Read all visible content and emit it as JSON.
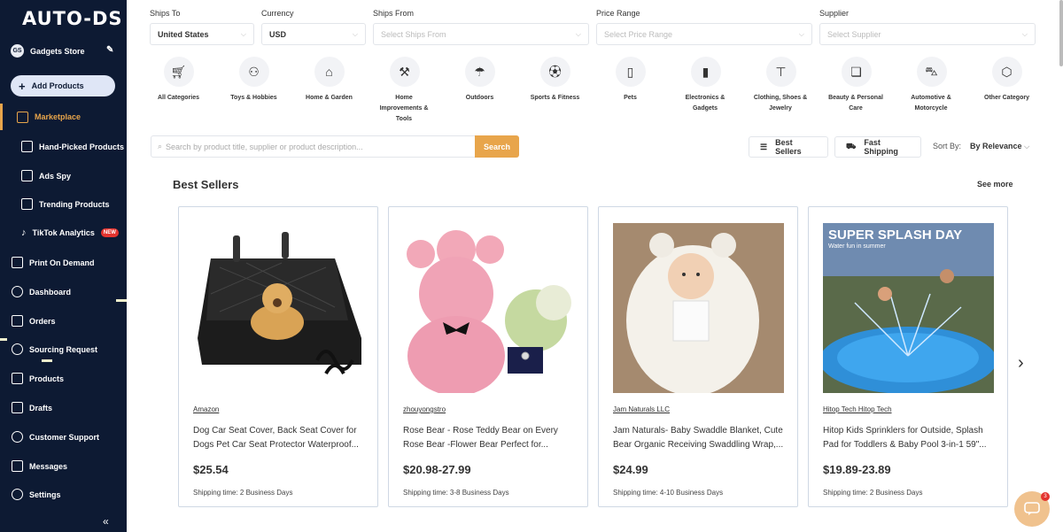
{
  "sidebar": {
    "logo": "AUTO-DS",
    "store_initials": "GS",
    "store_name": "Gadgets Store",
    "add_products": "Add Products",
    "items": {
      "marketplace": "Marketplace",
      "hand_picked": "Hand-Picked Products",
      "ads_spy": "Ads Spy",
      "trending": "Trending Products",
      "tiktok": "TikTok Analytics",
      "tiktok_badge": "NEW",
      "print_on_demand": "Print On Demand",
      "dashboard": "Dashboard",
      "orders": "Orders",
      "sourcing": "Sourcing Request",
      "products": "Products",
      "drafts": "Drafts",
      "support": "Customer Support",
      "messages": "Messages",
      "settings": "Settings"
    },
    "collapse_glyph": "«"
  },
  "filters": {
    "ships_to": {
      "label": "Ships To",
      "value": "United States"
    },
    "currency": {
      "label": "Currency",
      "value": "USD"
    },
    "ships_from": {
      "label": "Ships From",
      "placeholder": "Select Ships From"
    },
    "price_range": {
      "label": "Price Range",
      "placeholder": "Select Price Range"
    },
    "supplier": {
      "label": "Supplier",
      "placeholder": "Select Supplier"
    }
  },
  "categories": [
    {
      "label": "All Categories",
      "icon": "cart-icon"
    },
    {
      "label": "Toys & Hobbies",
      "icon": "gamepad-icon"
    },
    {
      "label": "Home & Garden",
      "icon": "house-icon"
    },
    {
      "label": "Home Improvements & Tools",
      "icon": "tools-icon"
    },
    {
      "label": "Outdoors",
      "icon": "umbrella-icon"
    },
    {
      "label": "Sports & Fitness",
      "icon": "ball-icon"
    },
    {
      "label": "Pets",
      "icon": "pet-icon"
    },
    {
      "label": "Electronics & Gadgets",
      "icon": "phone-icon"
    },
    {
      "label": "Clothing, Shoes & Jewelry",
      "icon": "shirt-icon"
    },
    {
      "label": "Beauty & Personal Care",
      "icon": "beauty-icon"
    },
    {
      "label": "Automotive & Motorcycle",
      "icon": "car-icon"
    },
    {
      "label": "Other Category",
      "icon": "box-icon"
    }
  ],
  "search": {
    "placeholder": "Search by product title, supplier or product description...",
    "button": "Search"
  },
  "toolbar": {
    "best_sellers": "Best Sellers",
    "fast_shipping": "Fast Shipping",
    "sort_by": "Sort By:",
    "sort_value": "By Relevance"
  },
  "section": {
    "title": "Best Sellers",
    "see_more": "See more"
  },
  "products": [
    {
      "supplier": "Amazon",
      "title": "Dog Car Seat Cover, Back Seat Cover for Dogs Pet Car Seat Protector Waterproof...",
      "price": "$25.54",
      "shipping": "Shipping time: 2 Business Days"
    },
    {
      "supplier": "zhouyongstro",
      "title": "Rose Bear - Rose Teddy Bear on Every Rose Bear -Flower Bear Perfect for...",
      "price": "$20.98-27.99",
      "shipping": "Shipping time: 3-8 Business Days"
    },
    {
      "supplier": "Jam Naturals LLC",
      "title": "Jam Naturals- Baby Swaddle Blanket, Cute Bear Organic Receiving Swaddling Wrap,...",
      "price": "$24.99",
      "shipping": "Shipping time: 4-10 Business Days"
    },
    {
      "supplier": "Hitop Tech Hitop Tech",
      "title": "Hitop Kids Sprinklers for Outside, Splash Pad for Toddlers & Baby Pool 3-in-1 59\"...",
      "price": "$19.89-23.89",
      "shipping": "Shipping time: 2 Business Days",
      "image_text": "SUPER SPLASH DAY",
      "image_subtext": "Water fun in summer"
    }
  ],
  "chat": {
    "count": "3"
  }
}
